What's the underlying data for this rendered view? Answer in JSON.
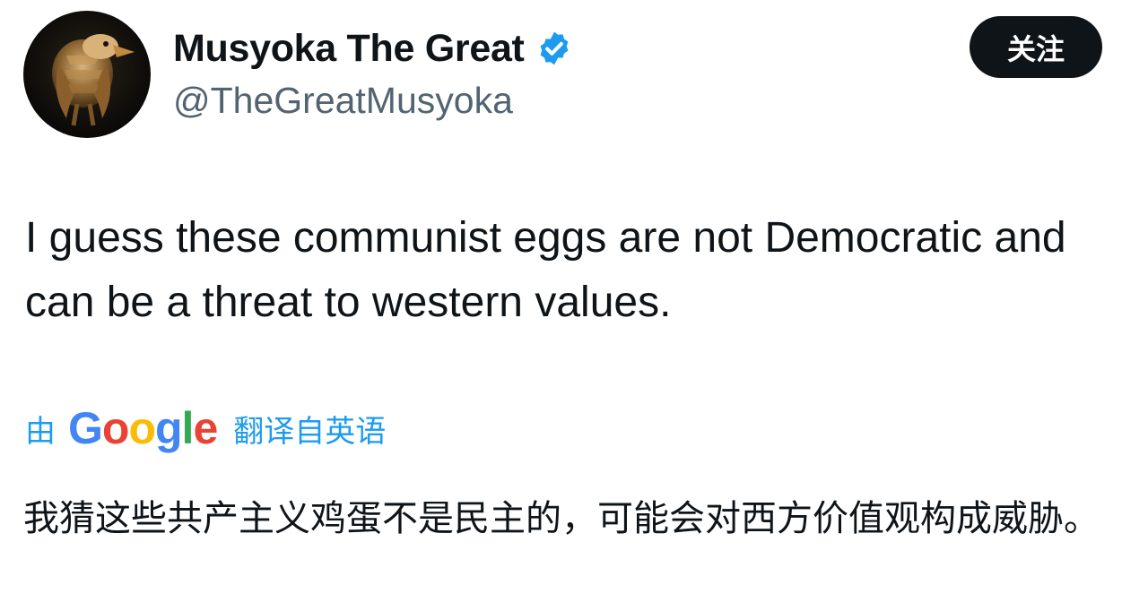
{
  "author": {
    "display_name": "Musyoka The Great",
    "handle": "@TheGreatMusyoka",
    "verified": true,
    "avatar_icon": "eagle-emblem-icon"
  },
  "follow_button": {
    "label": "关注"
  },
  "tweet": {
    "text": "I guess these communist eggs are not Democratic and can be a threat to western values."
  },
  "translation": {
    "prefix": "由",
    "provider": {
      "letters": [
        "G",
        "o",
        "o",
        "g",
        "l",
        "e"
      ]
    },
    "suffix": "翻译自英语",
    "text": "我猜这些共产主义鸡蛋不是民主的，可能会对西方价值观构成威胁。"
  },
  "colors": {
    "accent": "#1d9bf0",
    "text_primary": "#0f1419",
    "text_secondary": "#536471",
    "button_bg": "#0f1419",
    "verified": "#1d9bf0"
  }
}
